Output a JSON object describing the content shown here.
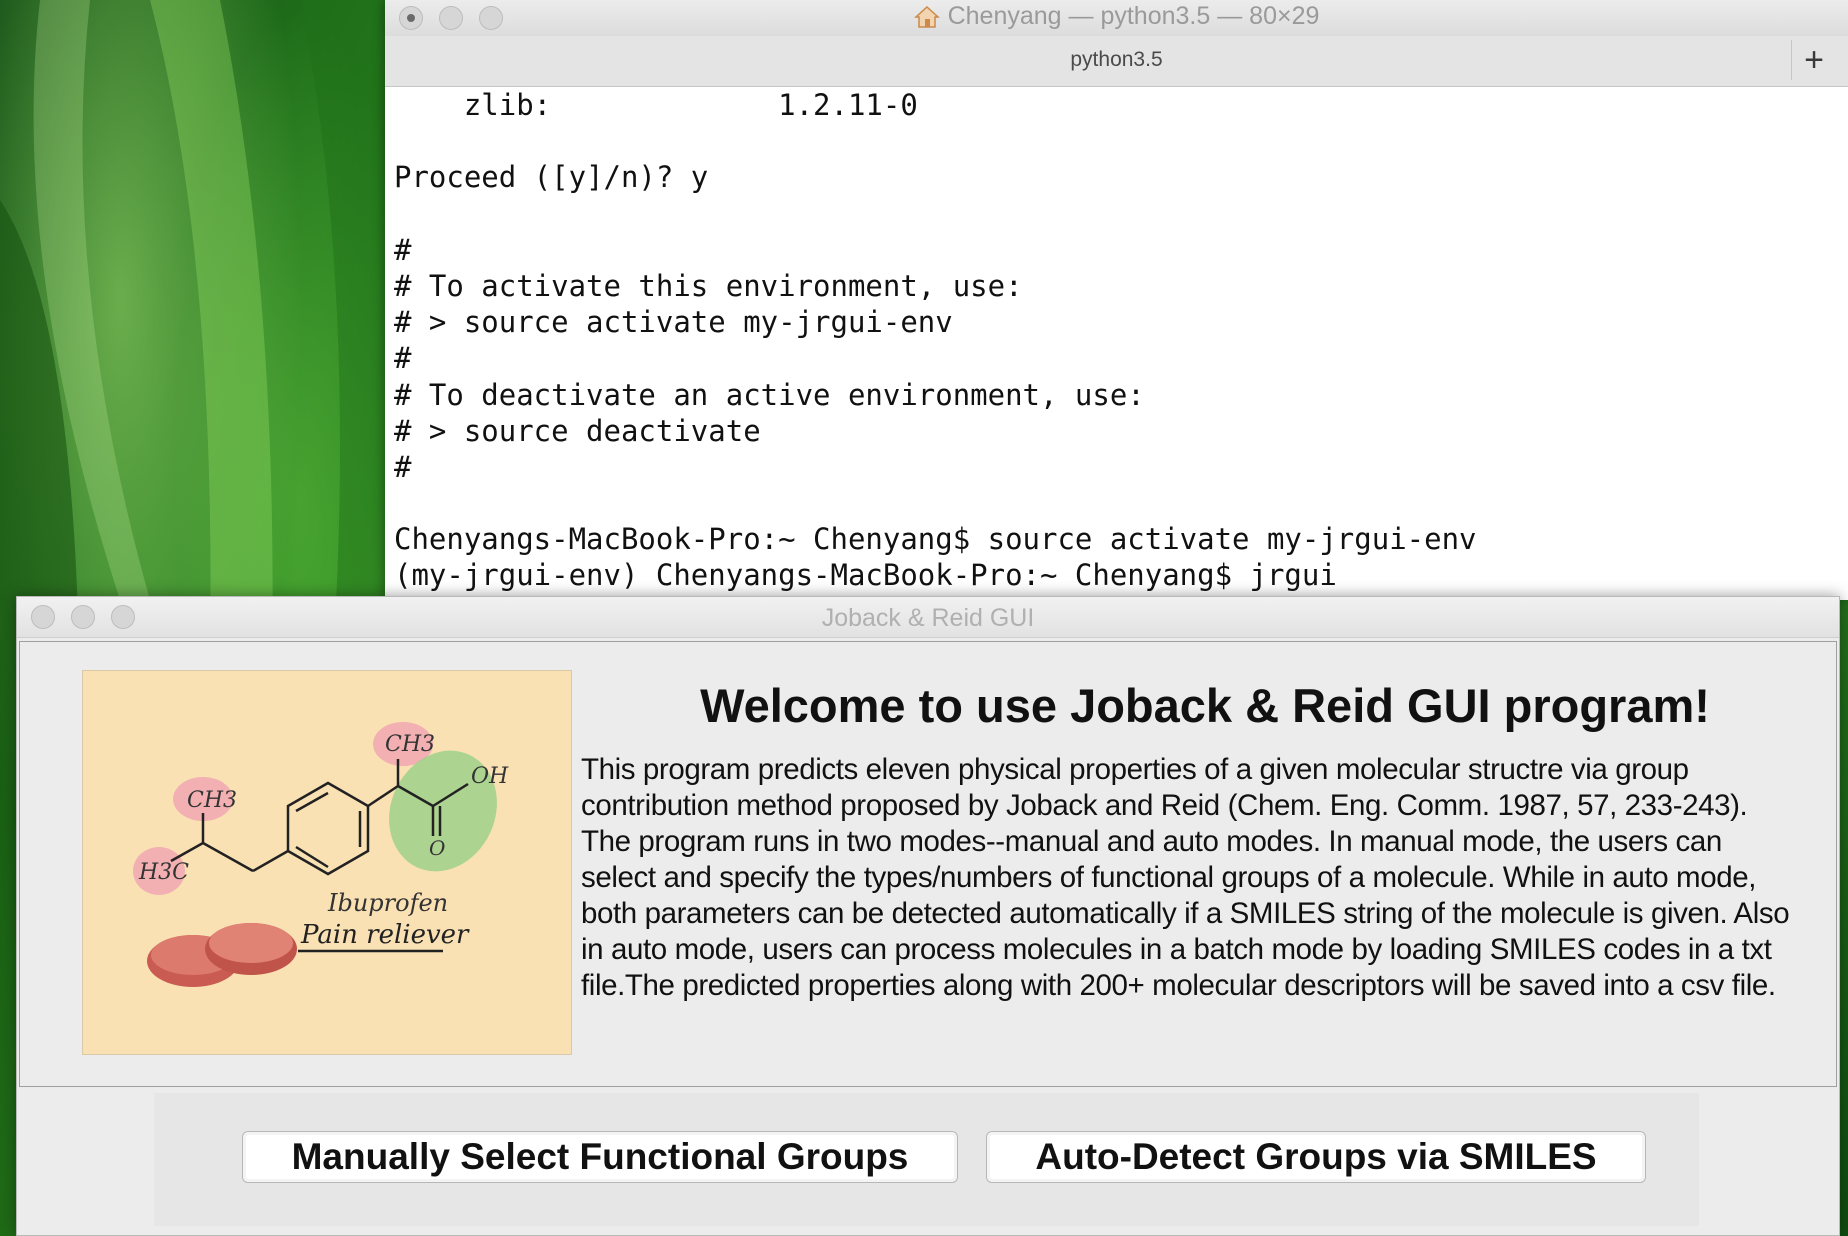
{
  "terminal": {
    "window_title": "Chenyang — python3.5 — 80×29",
    "tab_label": "python3.5",
    "new_tab_label": "+",
    "lines": [
      "    zlib:             1.2.11-0",
      "",
      "Proceed ([y]/n)? y",
      "",
      "#",
      "# To activate this environment, use:",
      "# > source activate my-jrgui-env",
      "#",
      "# To deactivate an active environment, use:",
      "# > source deactivate",
      "#",
      "",
      "Chenyangs-MacBook-Pro:~ Chenyang$ source activate my-jrgui-env",
      "(my-jrgui-env) Chenyangs-MacBook-Pro:~ Chenyang$ jrgui"
    ]
  },
  "gui": {
    "window_title": "Joback & Reid GUI",
    "welcome": "Welcome to use Joback & Reid GUI program!",
    "description": "This program predicts eleven physical properties of a given molecular structre via group contribution method proposed by Joback and Reid (Chem. Eng. Comm. 1987, 57, 233-243). The program runs in two modes--manual and auto modes. In manual mode, the users can select and specify the types/numbers of functional groups of a molecule. While in auto mode, both parameters can be detected automatically if a SMILES string of the molecule is given. Also in auto mode, users can process molecules in a batch mode by loading SMILES codes in a txt file.The predicted properties along with 200+ molecular descriptors will be saved into a csv file.",
    "image": {
      "label_ch3_left": "CH3",
      "label_ch3_top": "CH3",
      "label_h3c": "H3C",
      "label_oh": "OH",
      "label_o": "O",
      "caption": "Ibuprofen",
      "subcaption": "Pain reliever"
    },
    "buttons": {
      "manual": "Manually Select Functional Groups",
      "auto": "Auto-Detect Groups via SMILES"
    }
  }
}
